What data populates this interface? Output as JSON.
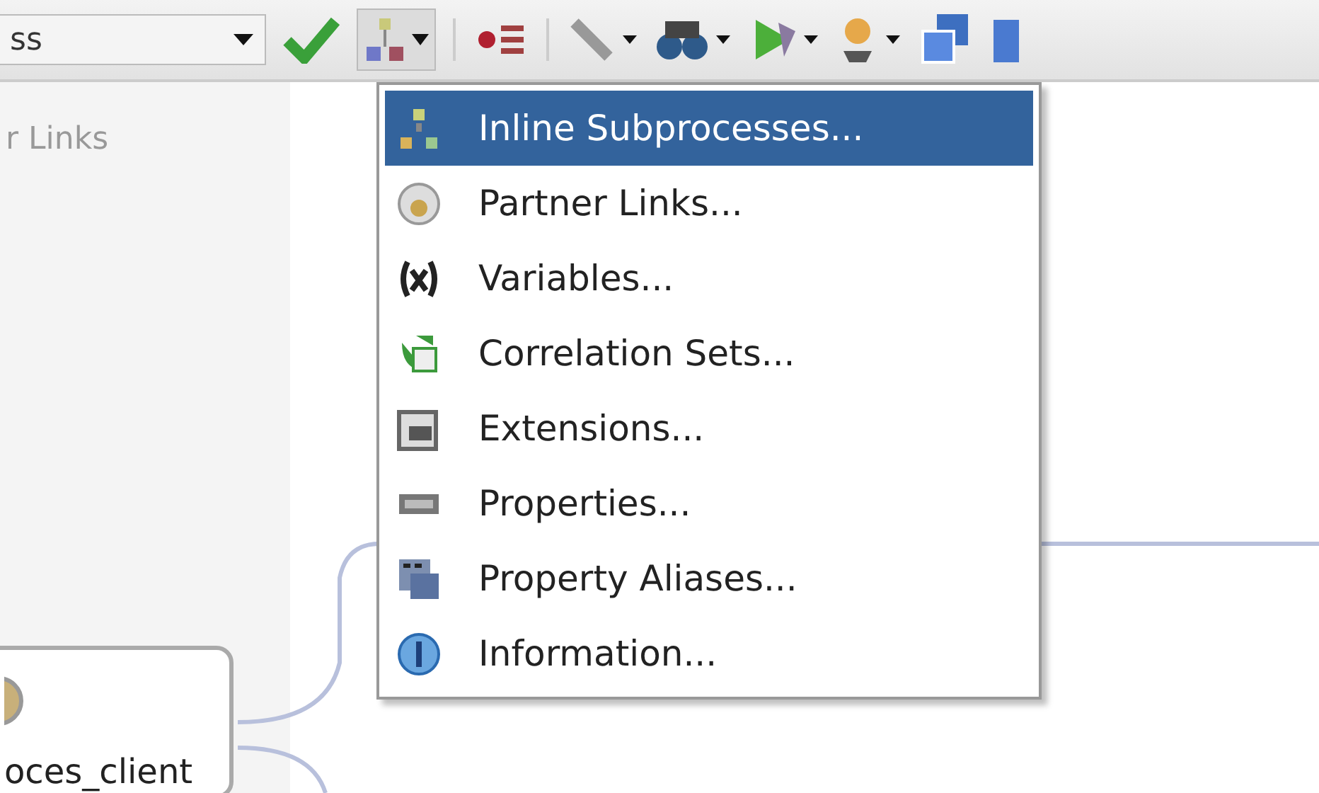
{
  "toolbar": {
    "combo_value": "ss"
  },
  "left_panel": {
    "label": "r Links"
  },
  "canvas": {
    "node_label": "oces_client"
  },
  "menu": {
    "items": [
      {
        "label": "Inline Subprocesses...",
        "kind": "subprocess",
        "selected": true
      },
      {
        "label": "Partner Links...",
        "kind": "partner",
        "selected": false
      },
      {
        "label": "Variables...",
        "kind": "variables",
        "selected": false
      },
      {
        "label": "Correlation Sets...",
        "kind": "correlation",
        "selected": false
      },
      {
        "label": "Extensions...",
        "kind": "extensions",
        "selected": false
      },
      {
        "label": "Properties...",
        "kind": "properties",
        "selected": false
      },
      {
        "label": "Property Aliases...",
        "kind": "aliases",
        "selected": false
      },
      {
        "label": "Information...",
        "kind": "info",
        "selected": false
      }
    ]
  }
}
